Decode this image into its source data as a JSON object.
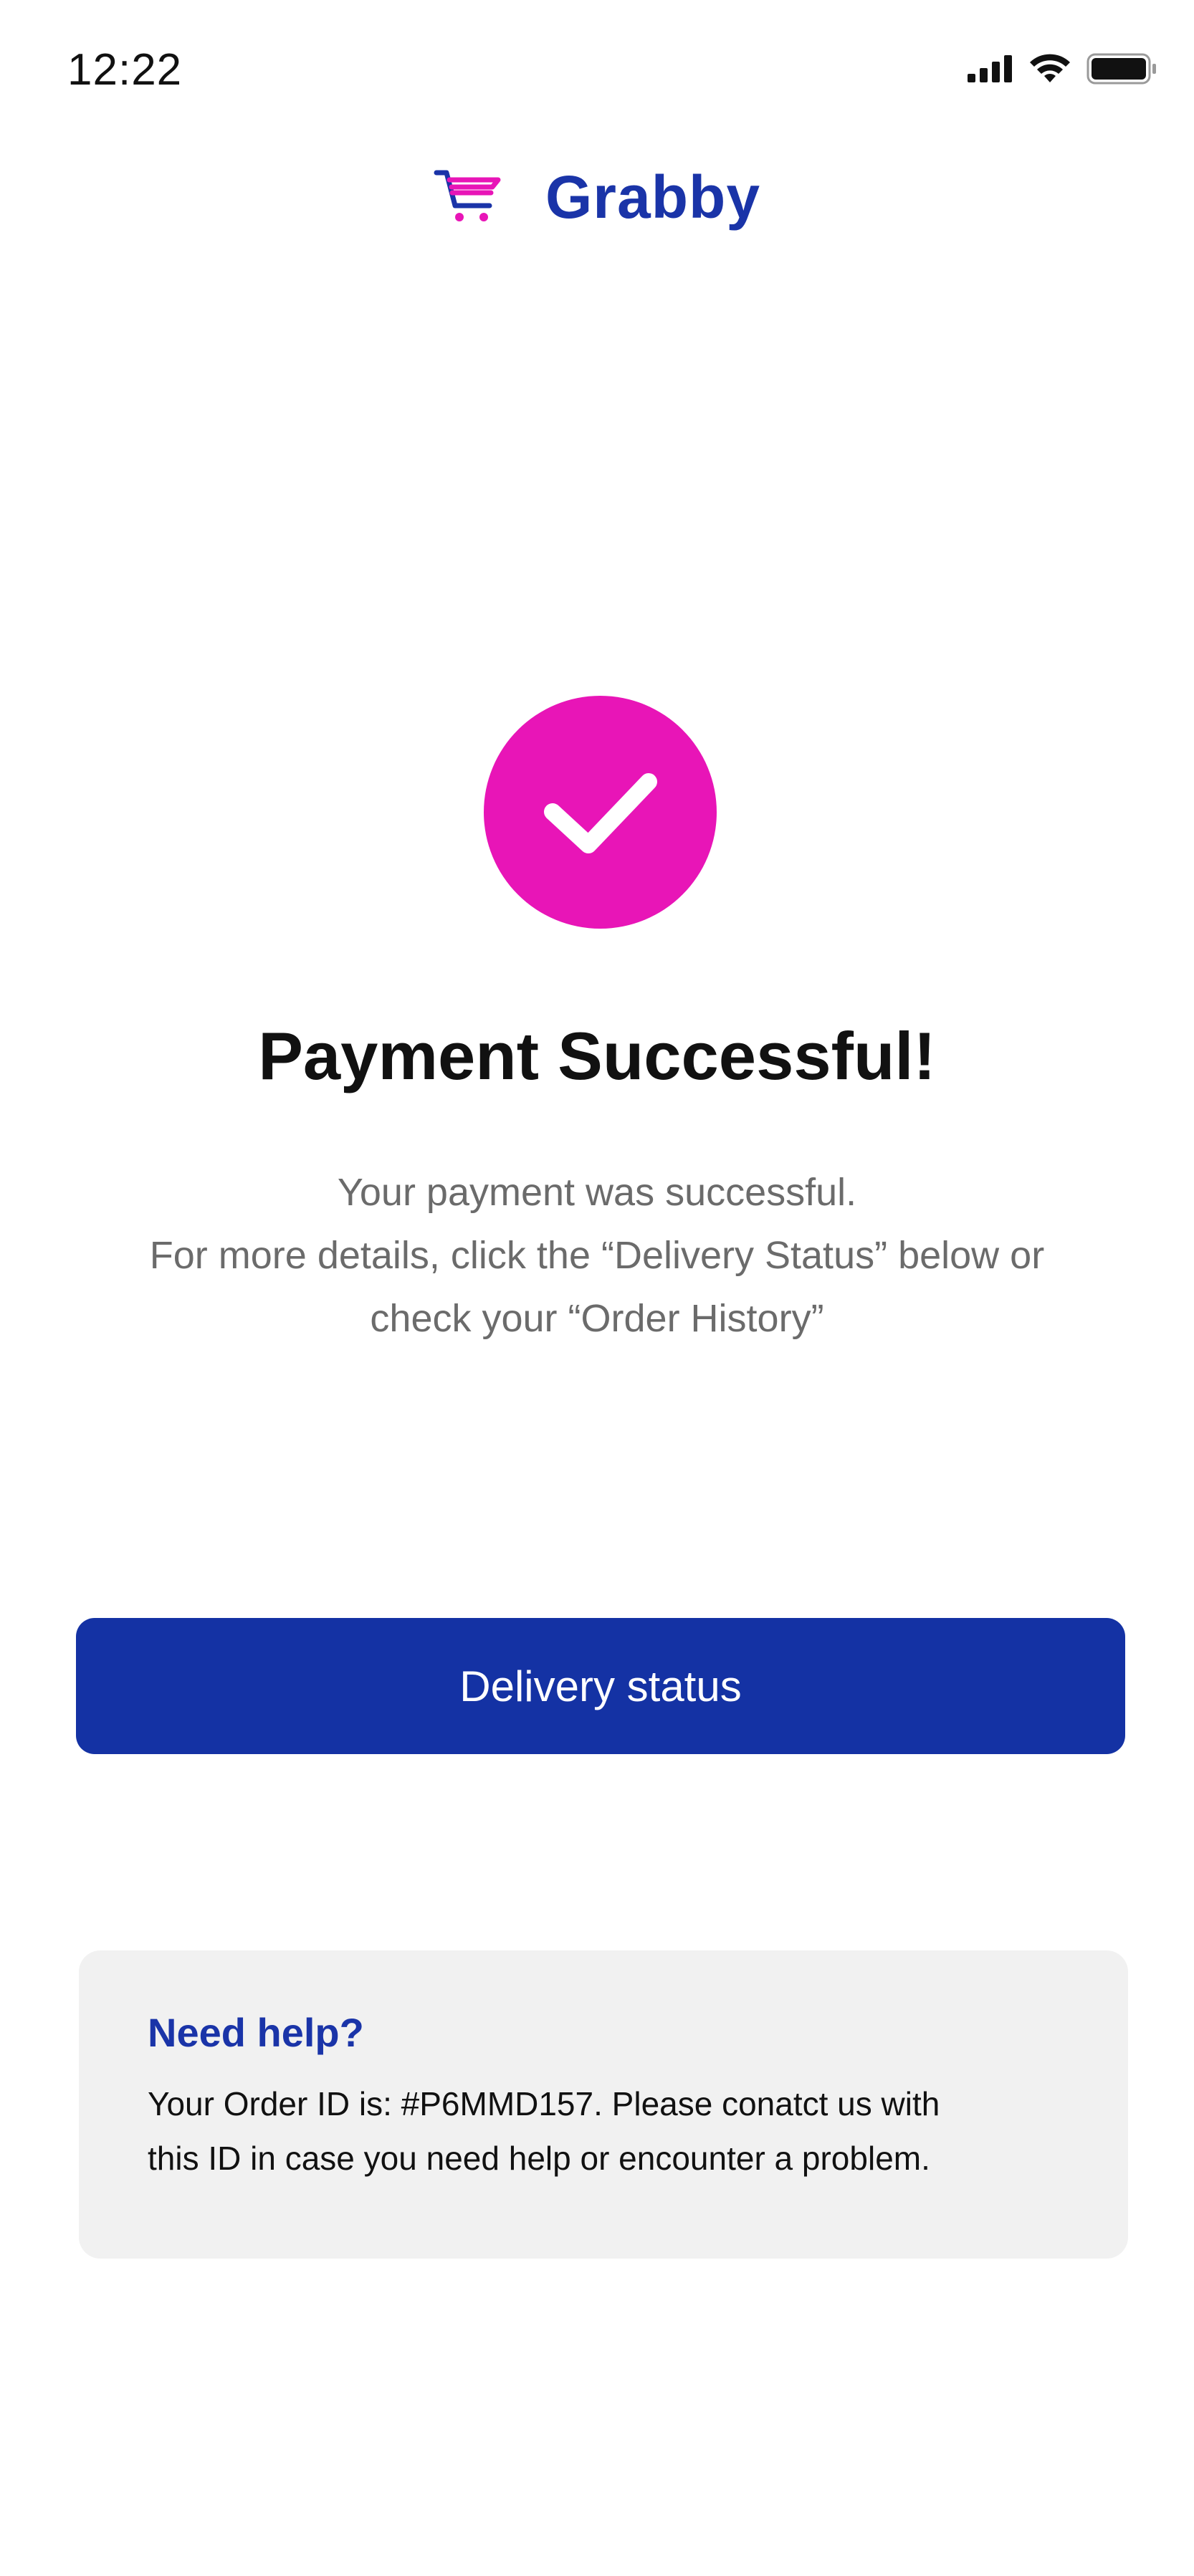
{
  "status_bar": {
    "time": "12:22"
  },
  "brand": {
    "name": "Grabby",
    "logo_icon": "cart-icon"
  },
  "success": {
    "icon": "check-icon",
    "color": "#e815b7"
  },
  "title": "Payment Successful!",
  "message": {
    "line1": "Your payment was successful.",
    "line2": "For more details, click the “Delivery Status” below or",
    "line3": "check your “Order History”"
  },
  "delivery_button": {
    "label": "Delivery status",
    "color": "#1432a4"
  },
  "help": {
    "title": "Need help?",
    "line1": "Your Order ID is: #P6MMD157. Please conatct us with",
    "line2": "this ID in case you need help or encounter a problem."
  }
}
